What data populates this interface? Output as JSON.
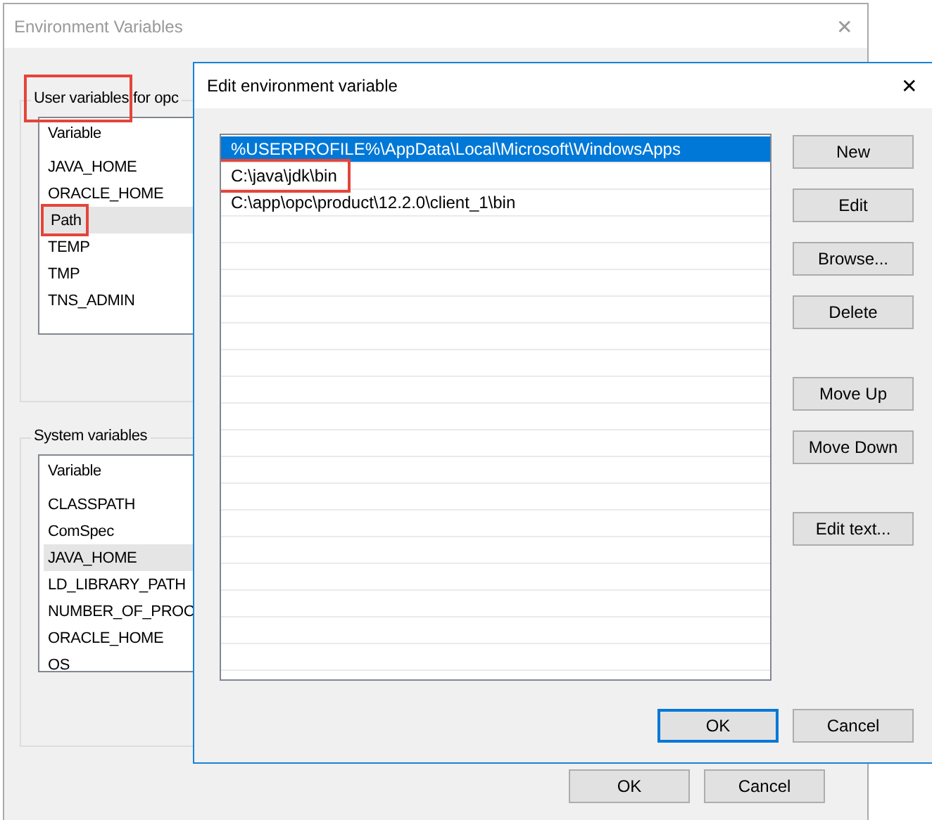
{
  "back_window": {
    "title": "Environment Variables",
    "close": "✕",
    "user_variables": {
      "label_parts": [
        {
          "text": "User variables",
          "annotated": true
        },
        {
          "text": "for opc",
          "annotated": false
        }
      ],
      "header": "Variable",
      "rows": [
        {
          "name": "JAVA_HOME",
          "selected": false,
          "annotated": false
        },
        {
          "name": "ORACLE_HOME",
          "selected": false,
          "annotated": false
        },
        {
          "name": "Path",
          "selected": true,
          "annotated": true
        },
        {
          "name": "TEMP",
          "selected": false,
          "annotated": false
        },
        {
          "name": "TMP",
          "selected": false,
          "annotated": false
        },
        {
          "name": "TNS_ADMIN",
          "selected": false,
          "annotated": false
        }
      ]
    },
    "system_variables": {
      "label_parts": [
        {
          "text": "System variables",
          "annotated": false
        }
      ],
      "header": "Variable",
      "rows": [
        {
          "name": "CLASSPATH",
          "selected": false,
          "annotated": false
        },
        {
          "name": "ComSpec",
          "selected": false,
          "annotated": false
        },
        {
          "name": "JAVA_HOME",
          "selected": true,
          "annotated": false
        },
        {
          "name": "LD_LIBRARY_PATH",
          "selected": false,
          "annotated": false
        },
        {
          "name": "NUMBER_OF_PROC",
          "selected": false,
          "annotated": false
        },
        {
          "name": "ORACLE_HOME",
          "selected": false,
          "annotated": false
        },
        {
          "name": "OS",
          "selected": false,
          "annotated": false
        }
      ]
    },
    "buttons": [
      {
        "label": "OK",
        "focused": false
      },
      {
        "label": "Cancel",
        "focused": false
      }
    ]
  },
  "edit_dialog": {
    "title": "Edit environment variable",
    "close": "✕",
    "entries": [
      {
        "text": "%USERPROFILE%\\AppData\\Local\\Microsoft\\WindowsApps",
        "selected": true,
        "annotated": false
      },
      {
        "text": "C:\\java\\jdk\\bin",
        "selected": false,
        "annotated": true
      },
      {
        "text": "C:\\app\\opc\\product\\12.2.0\\client_1\\bin",
        "selected": false,
        "annotated": false
      }
    ],
    "button_groups": [
      [
        "New",
        "Edit",
        "Browse...",
        "Delete"
      ],
      [
        "Move Up",
        "Move Down"
      ],
      [
        "Edit text..."
      ]
    ],
    "buttons": [
      {
        "label": "OK",
        "focused": true
      },
      {
        "label": "Cancel",
        "focused": false
      }
    ]
  }
}
